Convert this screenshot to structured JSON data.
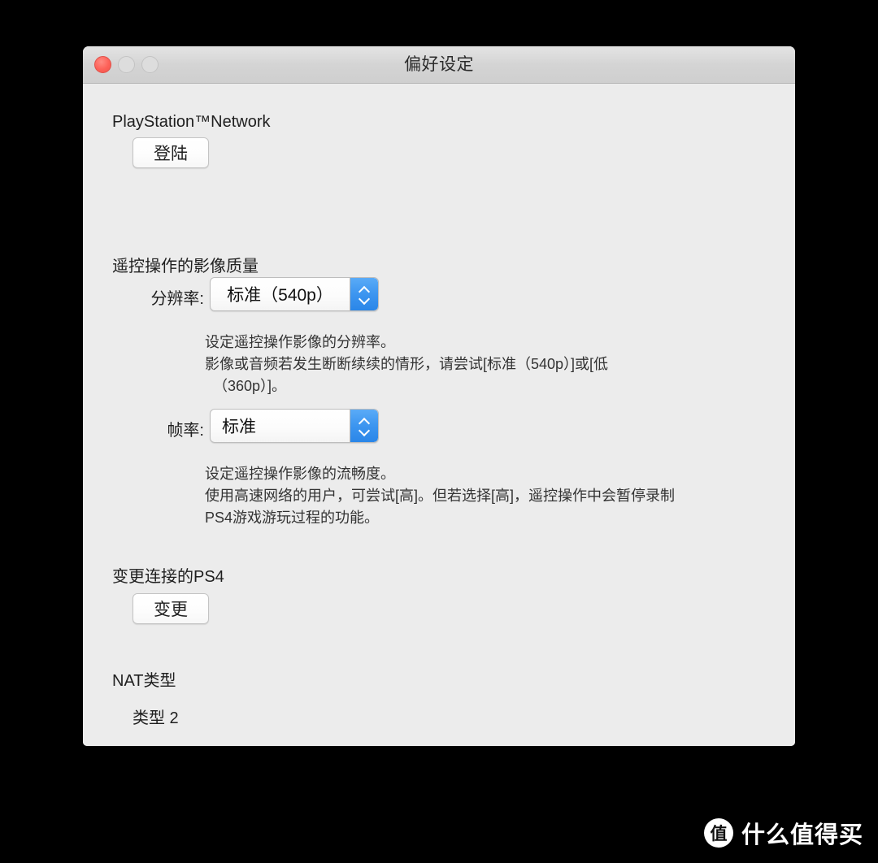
{
  "window": {
    "title": "偏好设定",
    "traffic_lights": [
      {
        "name": "close",
        "state": "active"
      },
      {
        "name": "minimize",
        "state": "disabled"
      },
      {
        "name": "zoom",
        "state": "disabled"
      }
    ]
  },
  "sections": {
    "psn": {
      "title": "PlayStation™Network",
      "signin_button": "登陆"
    },
    "video_quality": {
      "title": "遥控操作的影像质量",
      "resolution": {
        "label": "分辨率:",
        "value": "标准（540p）",
        "help_line1": "设定遥控操作影像的分辨率。",
        "help_line2": "影像或音频若发生断断续续的情形，请尝试[标准（540p）]或[低",
        "help_line3": "  （360p）]。"
      },
      "framerate": {
        "label": "帧率:",
        "value": "标准",
        "help_line1": "设定遥控操作影像的流畅度。",
        "help_line2": "使用高速网络的用户，可尝试[高]。但若选择[高]，遥控操作中会暂停录制",
        "help_line3": "PS4游戏游玩过程的功能。"
      }
    },
    "change_ps4": {
      "title": "变更连接的PS4",
      "change_button": "变更"
    },
    "nat": {
      "title": "NAT类型",
      "value": "类型 2"
    }
  },
  "watermark": {
    "badge": "值",
    "text": "什么值得买"
  },
  "colors": {
    "accent_blue": "#3d96f0",
    "close_red": "#fd6158",
    "window_bg": "#ececec",
    "titlebar_bg": "#d4d4d4"
  }
}
